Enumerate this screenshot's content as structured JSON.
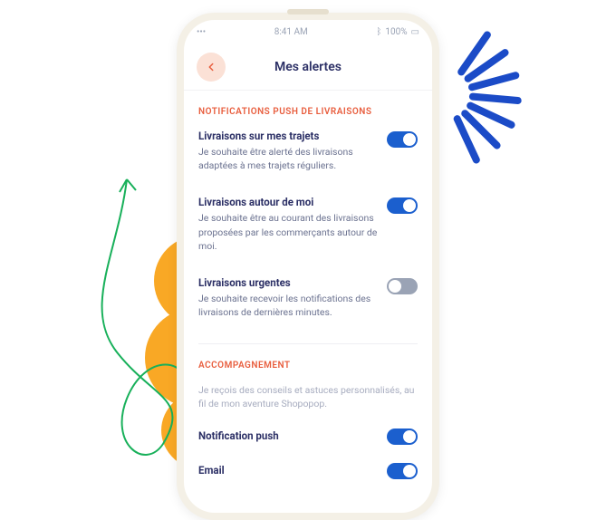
{
  "status": {
    "time": "8:41 AM",
    "battery": "100%"
  },
  "header": {
    "title": "Mes alertes",
    "back_icon": "arrow-left"
  },
  "sections": {
    "delivery": {
      "label": "NOTIFICATIONS PUSH DE LIVRAISONS",
      "items": [
        {
          "title": "Livraisons sur mes trajets",
          "desc": "Je souhaite être alerté des livraisons adaptées à mes trajets réguliers.",
          "on": true
        },
        {
          "title": "Livraisons autour de moi",
          "desc": "Je souhaite être au courant des livraisons proposées par les commerçants autour de moi.",
          "on": true
        },
        {
          "title": "Livraisons urgentes",
          "desc": "Je souhaite recevoir les notifications des livraisons de dernières minutes.",
          "on": false
        }
      ]
    },
    "accompagnement": {
      "label": "ACCOMPAGNEMENT",
      "desc": "Je reçois des conseils et astuces personnalisés, au fil de mon aventure Shopopop.",
      "items": [
        {
          "title": "Notification push",
          "on": true
        },
        {
          "title": "Email",
          "on": true
        }
      ]
    }
  },
  "colors": {
    "accent_orange": "#E85D3D",
    "brand_blue": "#1B5FCE",
    "dark_navy": "#2B2F65",
    "decor_orange": "#F9A825",
    "decor_blue": "#1B4BC7",
    "decor_green": "#18B05A"
  }
}
